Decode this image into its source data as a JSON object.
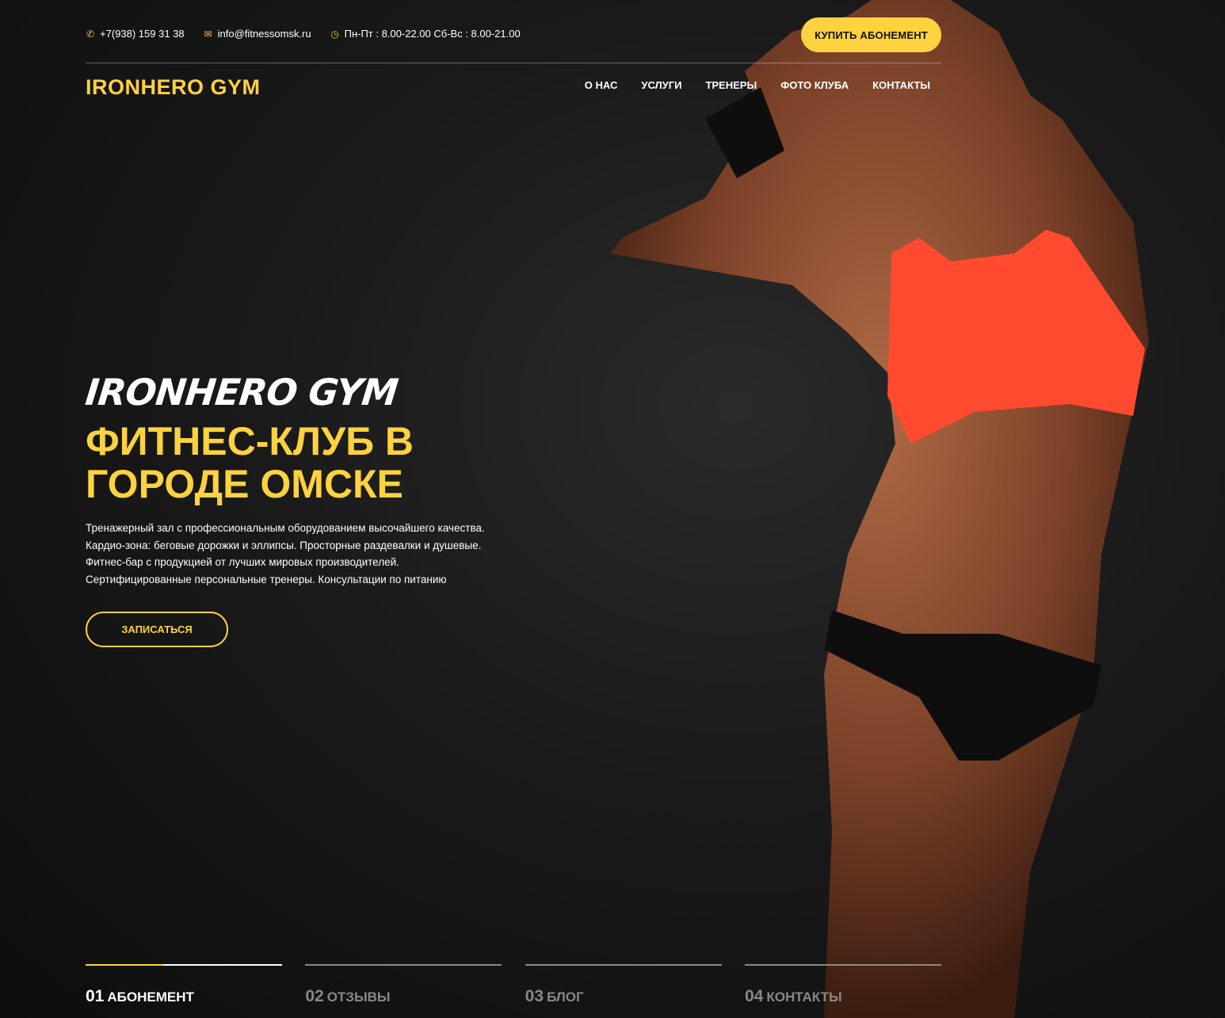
{
  "topbar": {
    "phone": "+7(938) 159 31 38",
    "email": "info@fitnessomsk.ru",
    "hours": "Пн-Пт : 8.00-22.00 Сб-Вс : 8.00-21.00",
    "buy_label": "КУПИТЬ АБОНЕМЕНТ"
  },
  "header": {
    "logo": "IRONHERO GYM",
    "nav": [
      "О НАС",
      "УСЛУГИ",
      "ТРЕНЕРЫ",
      "ФОТО КЛУБА",
      "КОНТАКТЫ"
    ]
  },
  "hero": {
    "script_title": "IRONHERO GYM",
    "headline_line1": "ФИТНЕС-КЛУБ В",
    "headline_line2": "ГОРОДЕ ОМСКЕ",
    "description": "Тренажерный зал с профессиональным оборудованием высочайшего качества. Кардио-зона: беговые дорожки и эллипсы. Просторные раздевалки и душевые. Фитнес-бар с продукцией от лучших мировых производителей. Сертифицированные персональные тренеры. Консультации по питанию",
    "signup_label": "ЗАПИСАТЬСЯ"
  },
  "tabs": [
    {
      "num": "01",
      "name": "АБОНЕМЕНТ",
      "active": true
    },
    {
      "num": "02",
      "name": "ОТЗЫВЫ",
      "active": false
    },
    {
      "num": "03",
      "name": "БЛОГ",
      "active": false
    },
    {
      "num": "04",
      "name": "КОНТАКТЫ",
      "active": false
    }
  ],
  "colors": {
    "accent": "#ffd23f",
    "background": "#151515",
    "top_red": "#ff4a2f"
  },
  "icons": {
    "phone": "phone-icon",
    "email": "envelope-icon",
    "hours": "clock-icon"
  }
}
